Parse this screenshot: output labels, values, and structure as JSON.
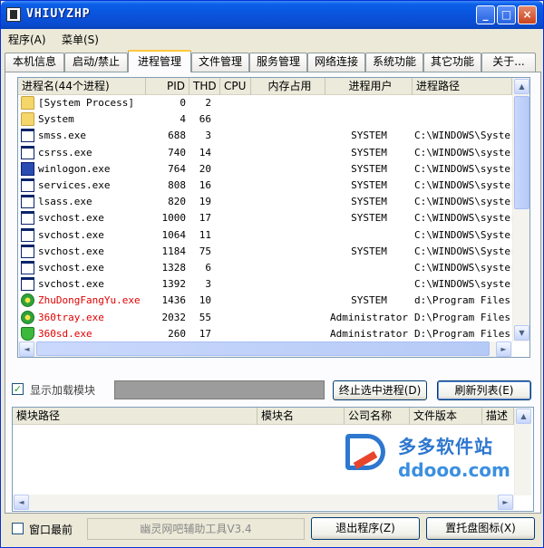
{
  "window": {
    "title": "VHIUYZHP",
    "min": "_",
    "max": "□",
    "close": "×"
  },
  "menu": {
    "items": [
      "程序(A)",
      "菜单(S)"
    ]
  },
  "tabs": [
    "本机信息",
    "启动/禁止",
    "进程管理",
    "文件管理",
    "服务管理",
    "网络连接",
    "系统功能",
    "其它功能",
    "关于..."
  ],
  "active_tab": "进程管理",
  "process_list": {
    "columns": [
      "进程名(44个进程)",
      "PID",
      "THD",
      "CPU",
      "内存占用",
      "进程用户",
      "进程路径"
    ],
    "rows": [
      {
        "icon": "folder-icon",
        "name": "[System Process]",
        "pid": "0",
        "thd": "2",
        "user": "",
        "path": "",
        "red": false
      },
      {
        "icon": "folder-icon",
        "name": "System",
        "pid": "4",
        "thd": "66",
        "user": "",
        "path": "",
        "red": false
      },
      {
        "icon": "window-icon",
        "name": "smss.exe",
        "pid": "688",
        "thd": "3",
        "user": "SYSTEM",
        "path": "C:\\WINDOWS\\Syster",
        "red": false
      },
      {
        "icon": "window-icon",
        "name": "csrss.exe",
        "pid": "740",
        "thd": "14",
        "user": "SYSTEM",
        "path": "C:\\WINDOWS\\syster",
        "red": false
      },
      {
        "icon": "winlogon-icon",
        "name": "winlogon.exe",
        "pid": "764",
        "thd": "20",
        "user": "SYSTEM",
        "path": "C:\\WINDOWS\\syster",
        "red": false
      },
      {
        "icon": "window-icon",
        "name": "services.exe",
        "pid": "808",
        "thd": "16",
        "user": "SYSTEM",
        "path": "C:\\WINDOWS\\syster",
        "red": false
      },
      {
        "icon": "window-icon",
        "name": "lsass.exe",
        "pid": "820",
        "thd": "19",
        "user": "SYSTEM",
        "path": "C:\\WINDOWS\\syster",
        "red": false
      },
      {
        "icon": "window-icon",
        "name": "svchost.exe",
        "pid": "1000",
        "thd": "17",
        "user": "SYSTEM",
        "path": "C:\\WINDOWS\\syster",
        "red": false
      },
      {
        "icon": "window-icon",
        "name": "svchost.exe",
        "pid": "1064",
        "thd": "11",
        "user": "",
        "path": "C:\\WINDOWS\\Syster",
        "red": false
      },
      {
        "icon": "window-icon",
        "name": "svchost.exe",
        "pid": "1184",
        "thd": "75",
        "user": "SYSTEM",
        "path": "C:\\WINDOWS\\Syster",
        "red": false
      },
      {
        "icon": "window-icon",
        "name": "svchost.exe",
        "pid": "1328",
        "thd": "6",
        "user": "",
        "path": "C:\\WINDOWS\\syster",
        "red": false
      },
      {
        "icon": "window-icon",
        "name": "svchost.exe",
        "pid": "1392",
        "thd": "3",
        "user": "",
        "path": "C:\\WINDOWS\\syster",
        "red": false
      },
      {
        "icon": "green-icon",
        "name": "ZhuDongFangYu.exe",
        "pid": "1436",
        "thd": "10",
        "user": "SYSTEM",
        "path": "d:\\Program Files",
        "red": true
      },
      {
        "icon": "green-icon",
        "name": "360tray.exe",
        "pid": "2032",
        "thd": "55",
        "user": "Administrator",
        "path": "D:\\Program Files",
        "red": true
      },
      {
        "icon": "shield-icon",
        "name": "360sd.exe",
        "pid": "260",
        "thd": "17",
        "user": "Administrator",
        "path": "D:\\Program Files",
        "red": true
      }
    ]
  },
  "controls": {
    "show_modules_label": "显示加载模块",
    "show_modules_checked": "✓",
    "kill_button": "终止选中进程(D)",
    "refresh_button": "刷新列表(E)"
  },
  "module_list": {
    "columns": [
      "模块路径",
      "模块名",
      "公司名称",
      "文件版本",
      "描述"
    ]
  },
  "watermark": {
    "cn": "多多软件站",
    "en": "ddooo.com"
  },
  "footer": {
    "topmost_label": "窗口最前",
    "version": "幽灵网吧辅助工具V3.4",
    "exit_button": "退出程序(Z)",
    "tray_button": "置托盘图标(X)"
  },
  "scroll": {
    "up": "▲",
    "down": "▼",
    "left": "◄",
    "right": "►"
  }
}
